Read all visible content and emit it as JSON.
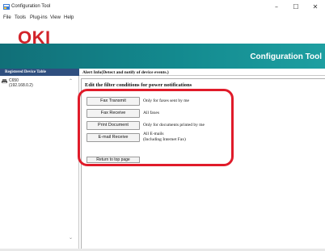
{
  "window": {
    "title": "Configuration Tool",
    "minimize_glyph": "–",
    "maximize_glyph": "☐",
    "close_glyph": "✕"
  },
  "menu": [
    "File",
    "Tools",
    "Plug-ins",
    "View",
    "Help"
  ],
  "brand": {
    "logo": "OKI",
    "logo_color": "#d2232a",
    "banner_title": "Configuration Tool",
    "banner_color": "#138a8f"
  },
  "sidebar": {
    "header": "Registered Device Table",
    "device": {
      "name": "C650",
      "ip": "(192.168.0.2)",
      "icon": "printer-icon"
    }
  },
  "content": {
    "header": "Alert Info(Detect and notify of device events.)",
    "subheading": "Edit the filter conditions for power notifications",
    "filters": [
      {
        "button": "Fax Transmit",
        "description": "Only for faxes sent by me"
      },
      {
        "button": "Fax Receive",
        "description": "All faxes"
      },
      {
        "button": "Print Document",
        "description": "Only for documents printed by me"
      },
      {
        "button": "E-mail Receive",
        "description": "All E-mails",
        "description2": "(Including Internet Fax)"
      }
    ],
    "return_button": "Return to top page"
  },
  "highlight_color": "#e01b2a"
}
